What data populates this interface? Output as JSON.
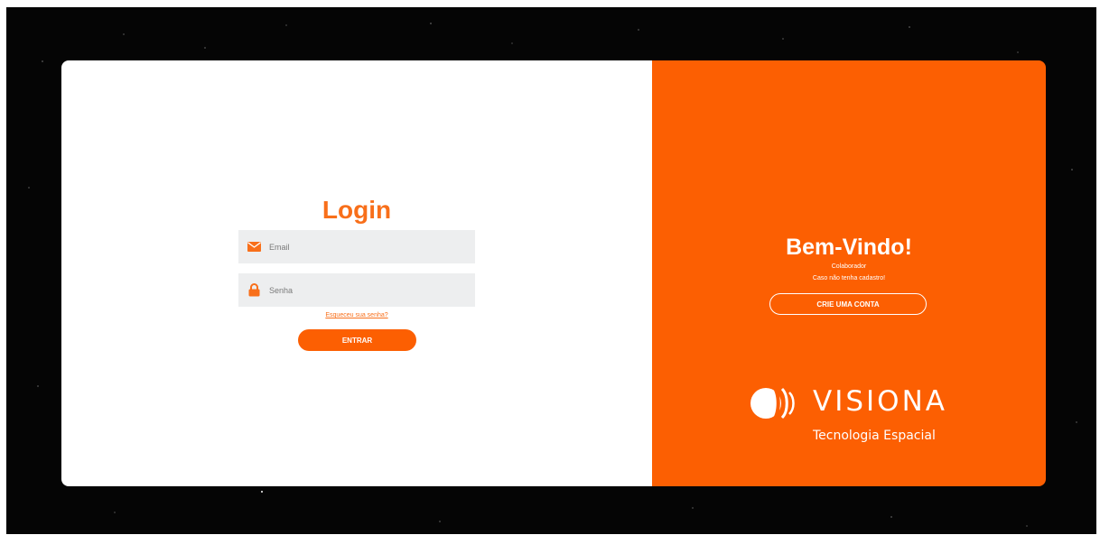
{
  "login": {
    "title": "Login",
    "email_placeholder": "Email",
    "password_placeholder": "Senha",
    "forgot_link": "Esqueceu sua senha?",
    "submit_label": "ENTRAR"
  },
  "welcome": {
    "title": "Bem-Vindo!",
    "subtitle": "Colaborador",
    "prompt": "Caso não tenha cadastro!",
    "create_account_label": "CRIE UMA CONTA"
  },
  "brand": {
    "name": "VISIONA",
    "tagline": "Tecnologia Espacial"
  },
  "icons": {
    "email": "envelope-icon",
    "password": "lock-icon"
  },
  "colors": {
    "accent": "#fc5f02",
    "title_orange": "#f86f1a",
    "input_bg": "#edeeef",
    "background": "#050505"
  }
}
